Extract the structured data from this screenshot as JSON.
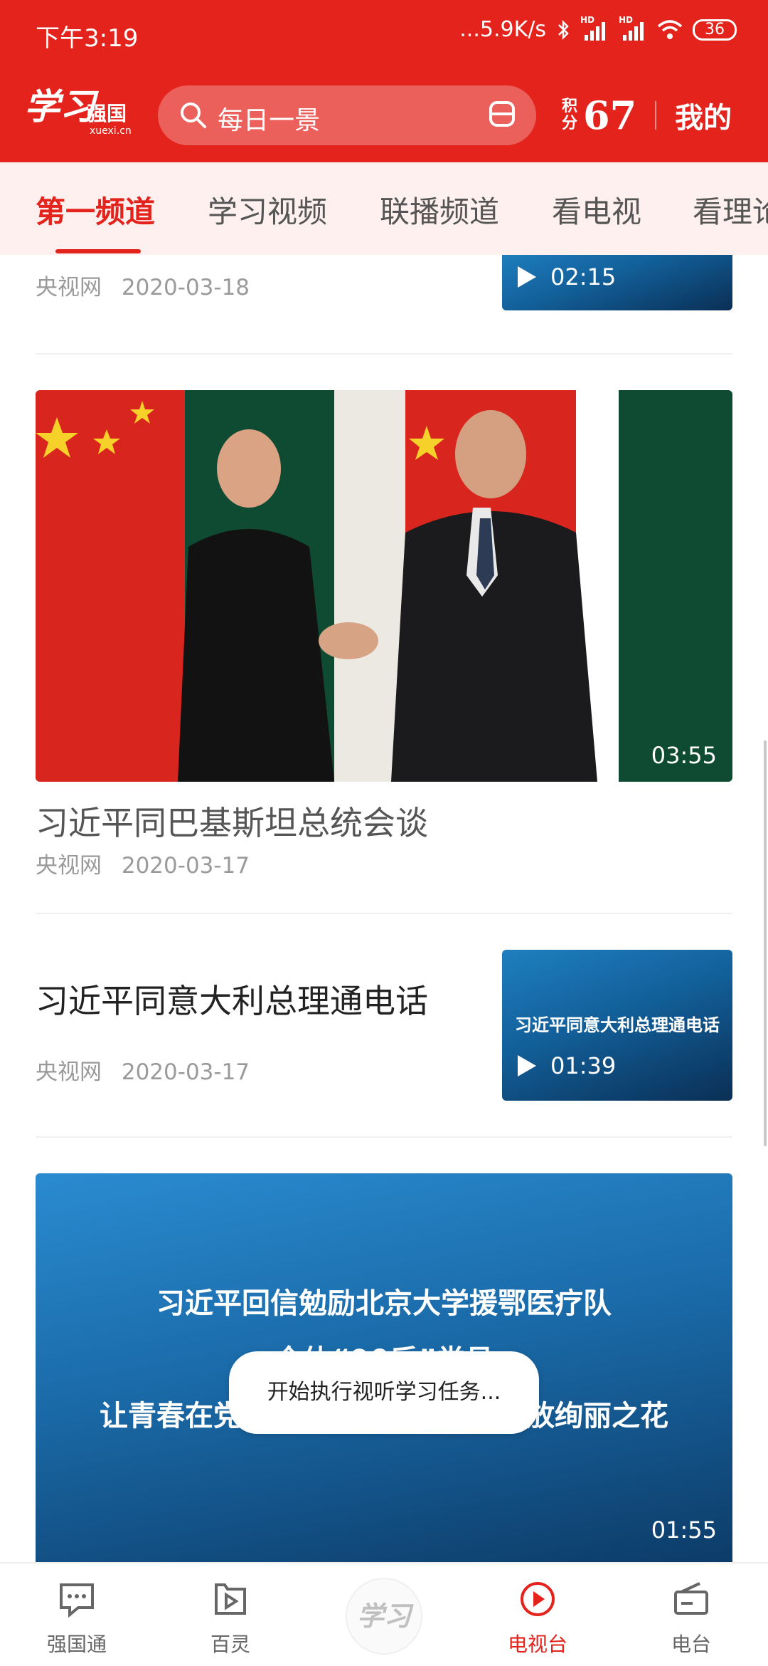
{
  "status_bar": {
    "time": "下午3:19",
    "net_speed": "...5.9K/s",
    "hd1": "HD",
    "hd2": "HD",
    "battery": "36"
  },
  "header": {
    "logo_script": "学习",
    "logo_text": "强国",
    "logo_url": "xuexi.cn",
    "search_placeholder": "每日一景",
    "points_label": "积分",
    "points_value": "67",
    "mine_label": "我的"
  },
  "tabs": [
    {
      "label": "第一频道",
      "active": true
    },
    {
      "label": "学习视频",
      "active": false
    },
    {
      "label": "联播频道",
      "active": false
    },
    {
      "label": "看电视",
      "active": false
    },
    {
      "label": "看理论",
      "active": false
    }
  ],
  "feed": {
    "item0": {
      "source": "央视网",
      "date": "2020-03-18",
      "duration": "02:15"
    },
    "item1": {
      "title": "习近平同巴基斯坦总统会谈",
      "source": "央视网",
      "date": "2020-03-17",
      "duration": "03:55"
    },
    "item2": {
      "title": "习近平同意大利总理通电话",
      "thumb_caption": "习近平同意大利总理通电话",
      "source": "央视网",
      "date": "2020-03-17",
      "duration": "01:39"
    },
    "item3": {
      "thumb_line1": "习近平回信勉励北京大学援鄂医疗队",
      "thumb_line2": "全体“90后”党员",
      "thumb_line3": "让青春在党和人民最需要的地方绽放绚丽之花",
      "duration": "01:55"
    }
  },
  "toast": "开始执行视听学习任务...",
  "bottom_nav": [
    {
      "label": "强国通",
      "icon": "chat-icon",
      "active": false
    },
    {
      "label": "百灵",
      "icon": "play-page-icon",
      "active": false
    },
    {
      "label": "学习",
      "icon": "xuexi-logo-icon",
      "active": false
    },
    {
      "label": "电视台",
      "icon": "play-circle-icon",
      "active": true
    },
    {
      "label": "电台",
      "icon": "radio-icon",
      "active": false
    }
  ],
  "colors": {
    "brand_red": "#e3231c",
    "tab_bg": "#fdf0ef",
    "thumb_blue": "#125f99"
  }
}
